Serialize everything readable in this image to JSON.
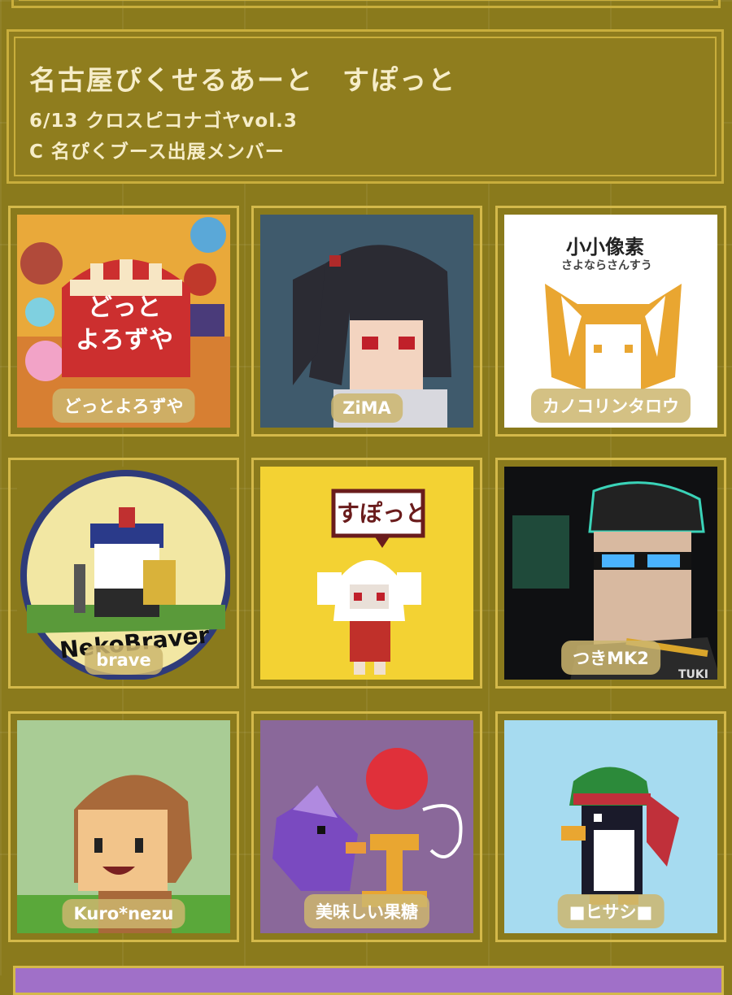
{
  "header": {
    "title": "名古屋ぴくせるあーと　すぽっと",
    "line1": "6/13 クロスピコナゴヤvol.3",
    "line2": "C 名ぴくブース出展メンバー"
  },
  "members": [
    {
      "name": "どっとよろずや",
      "art_text": "どっと\nよろずや"
    },
    {
      "name": "ZiMA"
    },
    {
      "name": "カノコリンタロウ",
      "art_text": "小小像素",
      "art_subtext": "さよならさんすう"
    },
    {
      "name": "brave",
      "art_text": "NekoBraver"
    },
    {
      "name": "",
      "art_text": "すぽっと"
    },
    {
      "name": "つきMK2",
      "art_text": "TUKI"
    },
    {
      "name": "Kuro*nezu"
    },
    {
      "name": "美味しい果糖"
    },
    {
      "name": "■ヒサシ■"
    }
  ],
  "colors": {
    "background": "#8a7a1c",
    "frame": "#d4b94a",
    "header_text": "#f6edc9"
  }
}
